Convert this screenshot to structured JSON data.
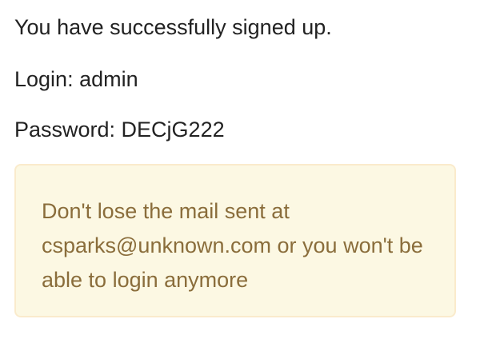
{
  "signup": {
    "success_message": "You have successfully signed up.",
    "login_line": "Login: admin",
    "password_line": "Password: DECjG222"
  },
  "warning": {
    "text": "Don't lose the mail sent at csparks@unknown.com or you won't be able to login anymore",
    "color": "#8a6d3b",
    "background": "#fcf8e3",
    "border": "#faebcc"
  }
}
